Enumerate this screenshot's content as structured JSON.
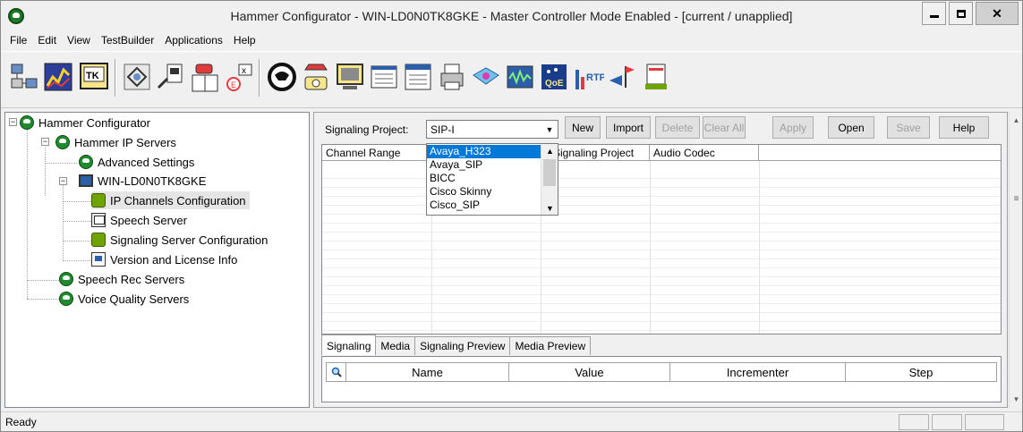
{
  "window": {
    "title": "Hammer Configurator - WIN-LD0N0TK8GKE - Master Controller Mode Enabled -  [current / unapplied]"
  },
  "menu": [
    "File",
    "Edit",
    "View",
    "TestBuilder",
    "Applications",
    "Help"
  ],
  "toolbar": {
    "icons": [
      "network-icon",
      "chart-icon",
      "tk-icon",
      "recycle-icon",
      "document-icon",
      "phone-book-icon",
      "export-icon",
      "hammer-logo-icon",
      "phone-icon",
      "monitor-icon",
      "list-icon",
      "reports-icon",
      "printer-icon",
      "network-map-icon",
      "waveform-icon",
      "qoe-icon",
      "rtp-icon",
      "flags-icon",
      "spreadsheet-icon"
    ]
  },
  "tree": {
    "root": "Hammer Configurator",
    "ip_servers": "Hammer IP Servers",
    "advanced_settings": "Advanced Settings",
    "host": "WIN-LD0N0TK8GKE",
    "ip_channels": "IP Channels Configuration",
    "speech_server": "Speech Server",
    "signaling_server": "Signaling Server Configuration",
    "version_info": "Version and License Info",
    "speech_rec": "Speech Rec Servers",
    "voice_quality": "Voice Quality Servers"
  },
  "panel": {
    "signaling_label": "Signaling Project:",
    "signaling_value": "SIP-I",
    "buttons": {
      "new": "New",
      "import": "Import",
      "delete": "Delete",
      "clear_all": "Clear All",
      "apply": "Apply",
      "open": "Open",
      "save": "Save",
      "help": "Help"
    },
    "columns": [
      "Channel Range",
      "",
      "Signaling Project",
      "Audio Codec"
    ],
    "dropdown_options": [
      "Avaya_H323",
      "Avaya_SIP",
      "BICC",
      "Cisco Skinny",
      "Cisco_SIP"
    ],
    "dropdown_selected": "Avaya_H323",
    "tabs": [
      "Signaling",
      "Media",
      "Signaling Preview",
      "Media Preview"
    ],
    "active_tab": "Signaling",
    "sub_columns": [
      "Name",
      "Value",
      "Incrementer",
      "Step"
    ]
  },
  "status": {
    "text": "Ready"
  }
}
